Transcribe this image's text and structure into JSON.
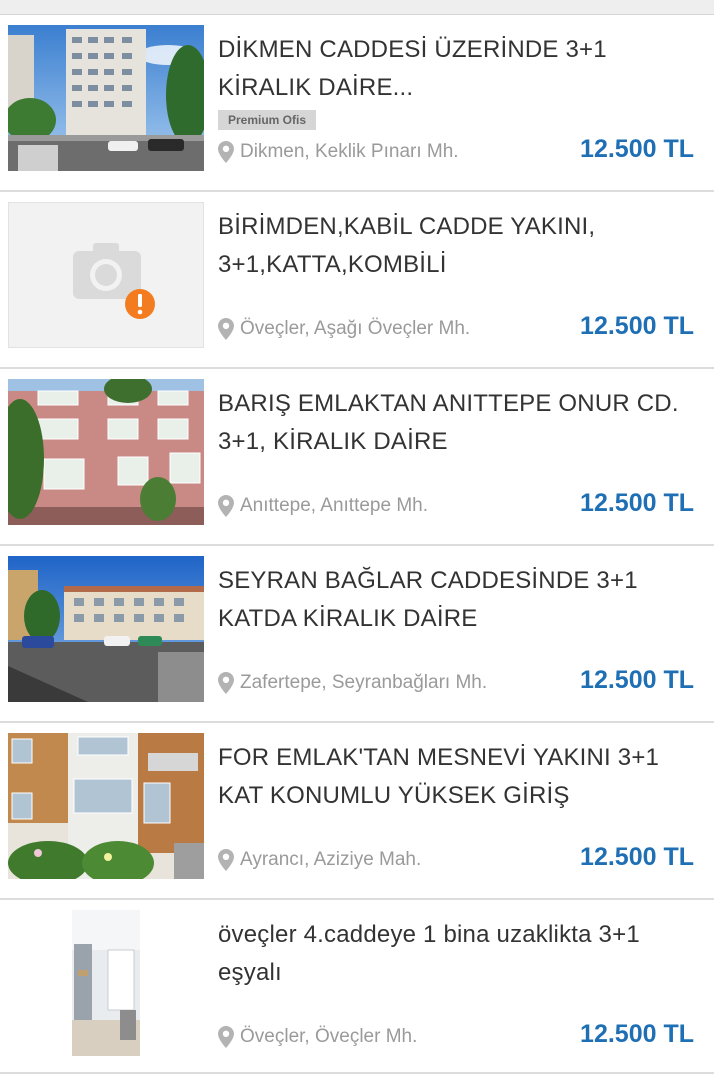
{
  "colors": {
    "price": "#1f6fb5",
    "title": "#333333",
    "location": "#9a9a9a",
    "divider": "#dcdcdc",
    "badge_bg": "#d6d6d6"
  },
  "listings": [
    {
      "title": "DİKMEN CADDESİ ÜZERİNDE 3+1 KİRALIK DAİRE...",
      "badge": "Premium Ofis",
      "location": "Dikmen, Keklik Pınarı Mh.",
      "price": "12.500 TL",
      "image": "apartment-tower-photo"
    },
    {
      "title": "BİRİMDEN,KABİL CADDE YAKINI, 3+1,KATTA,KOMBİLİ",
      "location": "Öveçler, Aşağı Öveçler Mh.",
      "price": "12.500 TL",
      "image": "no-photo-placeholder"
    },
    {
      "title": "BARIŞ EMLAKTAN ANITTEPE ONUR CD. 3+1, KİRALIK DAİRE",
      "location": "Anıttepe, Anıttepe Mh.",
      "price": "12.500 TL",
      "image": "pink-building-photo"
    },
    {
      "title": "SEYRAN BAĞLAR CADDESİNDE 3+1 KATDA KİRALIK DAİRE",
      "location": "Zafertepe, Seyranbağları Mh.",
      "price": "12.500 TL",
      "image": "street-building-photo"
    },
    {
      "title": "FOR EMLAK'TAN MESNEVİ YAKINI 3+1 KAT KONUMLU YÜKSEK GİRİŞ",
      "location": "Ayrancı, Aziziye Mah.",
      "price": "12.500 TL",
      "image": "building-entrance-photo"
    },
    {
      "title": "öveçler 4.caddeye 1 bina uzaklikta 3+1 eşyalı",
      "location": "Öveçler, Öveçler Mh.",
      "price": "12.500 TL",
      "image": "kitchen-photo"
    }
  ]
}
